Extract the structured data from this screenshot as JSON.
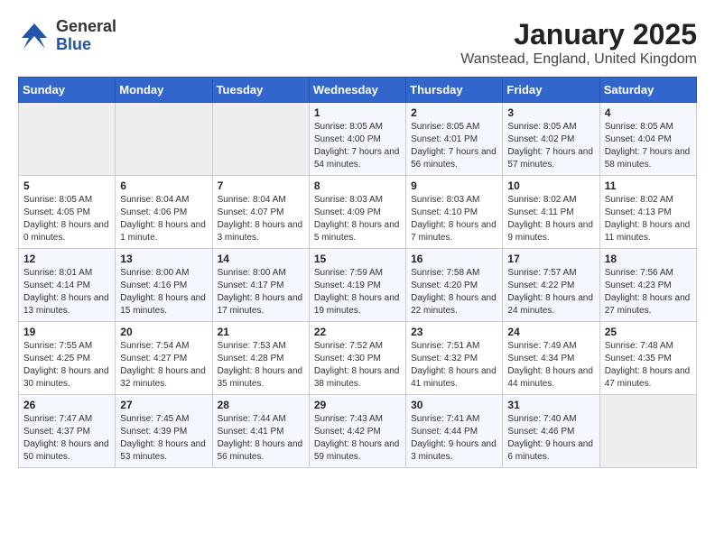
{
  "header": {
    "logo_general": "General",
    "logo_blue": "Blue",
    "title": "January 2025",
    "subtitle": "Wanstead, England, United Kingdom"
  },
  "days_of_week": [
    "Sunday",
    "Monday",
    "Tuesday",
    "Wednesday",
    "Thursday",
    "Friday",
    "Saturday"
  ],
  "weeks": [
    [
      {
        "day": "",
        "empty": true
      },
      {
        "day": "",
        "empty": true
      },
      {
        "day": "",
        "empty": true
      },
      {
        "day": "1",
        "sunrise": "8:05 AM",
        "sunset": "4:00 PM",
        "daylight": "7 hours and 54 minutes."
      },
      {
        "day": "2",
        "sunrise": "8:05 AM",
        "sunset": "4:01 PM",
        "daylight": "7 hours and 56 minutes."
      },
      {
        "day": "3",
        "sunrise": "8:05 AM",
        "sunset": "4:02 PM",
        "daylight": "7 hours and 57 minutes."
      },
      {
        "day": "4",
        "sunrise": "8:05 AM",
        "sunset": "4:04 PM",
        "daylight": "7 hours and 58 minutes."
      }
    ],
    [
      {
        "day": "5",
        "sunrise": "8:05 AM",
        "sunset": "4:05 PM",
        "daylight": "8 hours and 0 minutes."
      },
      {
        "day": "6",
        "sunrise": "8:04 AM",
        "sunset": "4:06 PM",
        "daylight": "8 hours and 1 minute."
      },
      {
        "day": "7",
        "sunrise": "8:04 AM",
        "sunset": "4:07 PM",
        "daylight": "8 hours and 3 minutes."
      },
      {
        "day": "8",
        "sunrise": "8:03 AM",
        "sunset": "4:09 PM",
        "daylight": "8 hours and 5 minutes."
      },
      {
        "day": "9",
        "sunrise": "8:03 AM",
        "sunset": "4:10 PM",
        "daylight": "8 hours and 7 minutes."
      },
      {
        "day": "10",
        "sunrise": "8:02 AM",
        "sunset": "4:11 PM",
        "daylight": "8 hours and 9 minutes."
      },
      {
        "day": "11",
        "sunrise": "8:02 AM",
        "sunset": "4:13 PM",
        "daylight": "8 hours and 11 minutes."
      }
    ],
    [
      {
        "day": "12",
        "sunrise": "8:01 AM",
        "sunset": "4:14 PM",
        "daylight": "8 hours and 13 minutes."
      },
      {
        "day": "13",
        "sunrise": "8:00 AM",
        "sunset": "4:16 PM",
        "daylight": "8 hours and 15 minutes."
      },
      {
        "day": "14",
        "sunrise": "8:00 AM",
        "sunset": "4:17 PM",
        "daylight": "8 hours and 17 minutes."
      },
      {
        "day": "15",
        "sunrise": "7:59 AM",
        "sunset": "4:19 PM",
        "daylight": "8 hours and 19 minutes."
      },
      {
        "day": "16",
        "sunrise": "7:58 AM",
        "sunset": "4:20 PM",
        "daylight": "8 hours and 22 minutes."
      },
      {
        "day": "17",
        "sunrise": "7:57 AM",
        "sunset": "4:22 PM",
        "daylight": "8 hours and 24 minutes."
      },
      {
        "day": "18",
        "sunrise": "7:56 AM",
        "sunset": "4:23 PM",
        "daylight": "8 hours and 27 minutes."
      }
    ],
    [
      {
        "day": "19",
        "sunrise": "7:55 AM",
        "sunset": "4:25 PM",
        "daylight": "8 hours and 30 minutes."
      },
      {
        "day": "20",
        "sunrise": "7:54 AM",
        "sunset": "4:27 PM",
        "daylight": "8 hours and 32 minutes."
      },
      {
        "day": "21",
        "sunrise": "7:53 AM",
        "sunset": "4:28 PM",
        "daylight": "8 hours and 35 minutes."
      },
      {
        "day": "22",
        "sunrise": "7:52 AM",
        "sunset": "4:30 PM",
        "daylight": "8 hours and 38 minutes."
      },
      {
        "day": "23",
        "sunrise": "7:51 AM",
        "sunset": "4:32 PM",
        "daylight": "8 hours and 41 minutes."
      },
      {
        "day": "24",
        "sunrise": "7:49 AM",
        "sunset": "4:34 PM",
        "daylight": "8 hours and 44 minutes."
      },
      {
        "day": "25",
        "sunrise": "7:48 AM",
        "sunset": "4:35 PM",
        "daylight": "8 hours and 47 minutes."
      }
    ],
    [
      {
        "day": "26",
        "sunrise": "7:47 AM",
        "sunset": "4:37 PM",
        "daylight": "8 hours and 50 minutes."
      },
      {
        "day": "27",
        "sunrise": "7:45 AM",
        "sunset": "4:39 PM",
        "daylight": "8 hours and 53 minutes."
      },
      {
        "day": "28",
        "sunrise": "7:44 AM",
        "sunset": "4:41 PM",
        "daylight": "8 hours and 56 minutes."
      },
      {
        "day": "29",
        "sunrise": "7:43 AM",
        "sunset": "4:42 PM",
        "daylight": "8 hours and 59 minutes."
      },
      {
        "day": "30",
        "sunrise": "7:41 AM",
        "sunset": "4:44 PM",
        "daylight": "9 hours and 3 minutes."
      },
      {
        "day": "31",
        "sunrise": "7:40 AM",
        "sunset": "4:46 PM",
        "daylight": "9 hours and 6 minutes."
      },
      {
        "day": "",
        "empty": true
      }
    ]
  ]
}
